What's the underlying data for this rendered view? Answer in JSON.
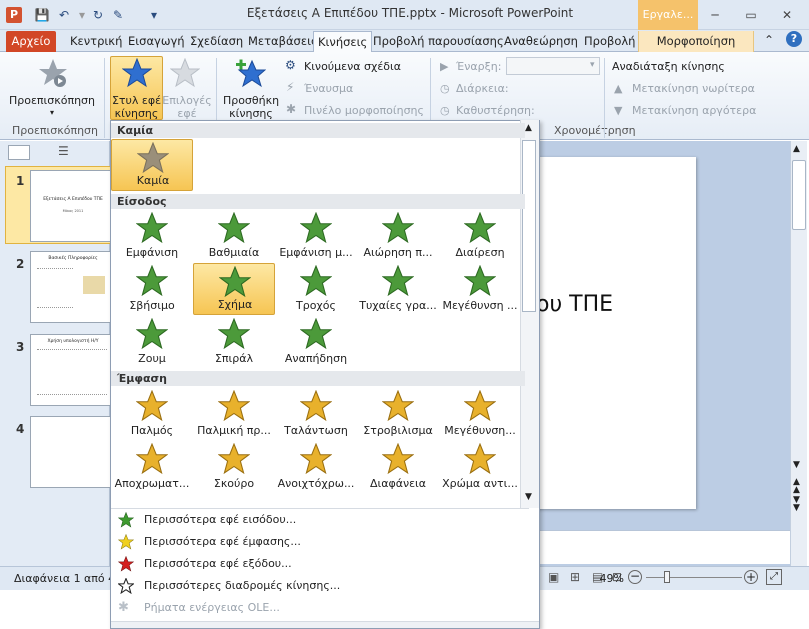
{
  "window": {
    "title": "Εξετάσεις Α Επιπέδου ΤΠΕ.pptx - Microsoft PowerPoint",
    "context_tab_group": "Εργαλε...",
    "app_icon": "P"
  },
  "tabs": [
    "Αρχείο",
    "Κεντρική",
    "Εισαγωγή",
    "Σχεδίαση",
    "Μεταβάσεις",
    "Κινήσεις",
    "Προβολή παρουσίασης",
    "Αναθεώρηση",
    "Προβολή",
    "Μορφοποίηση"
  ],
  "ribbon": {
    "preview_label": "Προεπισκόπηση",
    "effect_style_label": "Στυλ εφέ κίνησης",
    "effect_options_label": "Επιλογές εφέ",
    "add_animation_label": "Προσθήκη κίνησης",
    "animation_painter": "Κινούμενα σχέδια",
    "trigger": "Έναυσμα",
    "animation_pane": "Πινέλο μορφοποίησης",
    "start_label": "Έναρξη:",
    "duration_label": "Διάρκεια:",
    "delay_label": "Καθυστέρηση:",
    "reorder_title": "Αναδιάταξη κίνησης",
    "move_earlier": "Μετακίνηση νωρίτερα",
    "move_later": "Μετακίνηση αργότερα",
    "group_preview": "Προεπισκόπηση",
    "group_timing": "Χρονομέτρηση"
  },
  "gallery": {
    "none_header": "Καμία",
    "none_item": "Καμία",
    "entrance_header": "Είσοδος",
    "entrance": [
      "Εμφάνιση",
      "Βαθμιαία",
      "Εμφάνιση μ...",
      "Αιώρηση π...",
      "Διαίρεση",
      "Σβήσιμο",
      "Σχήμα",
      "Τροχός",
      "Τυχαίες γρα...",
      "Μεγέθυνση ...",
      "Ζουμ",
      "Σπιράλ",
      "Αναπήδηση"
    ],
    "emphasis_header": "Έμφαση",
    "emphasis": [
      "Παλμός",
      "Παλμική πρ...",
      "Ταλάντωση",
      "Στροβιλισμα",
      "Μεγέθυνση...",
      "Αποχρωματ...",
      "Σκούρο",
      "Ανοιχτόχρω...",
      "Διαφάνεια",
      "Χρώμα αντι..."
    ],
    "selected": "Σχήμα"
  },
  "menu": [
    {
      "label": "Περισσότερα εφέ εισόδου...",
      "icon": "green-star-icon",
      "enabled": true
    },
    {
      "label": "Περισσότερα εφέ έμφασης...",
      "icon": "yellow-star-icon",
      "enabled": true
    },
    {
      "label": "Περισσότερα εφέ εξόδου...",
      "icon": "red-star-icon",
      "enabled": true
    },
    {
      "label": "Περισσότερες διαδρομές κίνησης...",
      "icon": "outline-star-icon",
      "enabled": true
    },
    {
      "label": "Ρήματα ενέργειας OLE...",
      "icon": "gear-icon",
      "enabled": false
    }
  ],
  "slides": [
    {
      "num": "1",
      "title": "Εξετάσεις Α Επιπέδου ΤΠΕ",
      "sub": "Μάιος 2011"
    },
    {
      "num": "2",
      "title": "Βασικές Πληροφορίες",
      "sub": ""
    },
    {
      "num": "3",
      "title": "Χρήση υπολογιστή Η/Υ",
      "sub": ""
    },
    {
      "num": "4",
      "title": "",
      "sub": ""
    }
  ],
  "slide_main_text": "ου ΤΠΕ",
  "status": {
    "slide_info": "Διαφάνεια 1 από 4",
    "zoom": "49%"
  },
  "colors": {
    "accent": "#d24726",
    "selected": "#f6c553",
    "entrance": "#4c9a3a",
    "emphasis": "#e8b12c"
  }
}
